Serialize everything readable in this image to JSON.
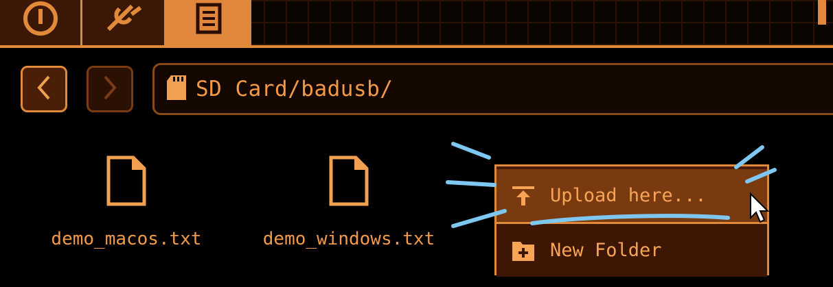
{
  "tabs": [
    {
      "name": "power",
      "icon": "power-icon"
    },
    {
      "name": "tools",
      "icon": "wrench-icon"
    },
    {
      "name": "files",
      "icon": "document-icon",
      "active": true
    }
  ],
  "navigation": {
    "back_icon": "chevron-left-icon",
    "forward_icon": "chevron-right-icon",
    "path_icon": "sd-card-icon",
    "path": "SD Card/badusb/"
  },
  "files": [
    {
      "name": "demo_macos.txt",
      "icon": "file-icon"
    },
    {
      "name": "demo_windows.txt",
      "icon": "file-icon"
    }
  ],
  "context_menu": {
    "items": [
      {
        "label": "Upload here...",
        "icon": "upload-icon",
        "highlighted": true
      },
      {
        "label": "New Folder",
        "icon": "new-folder-icon"
      }
    ]
  },
  "colors": {
    "accent": "#e08a3a",
    "text": "#f09a4a",
    "background": "#000000",
    "highlight": "#7a3a10",
    "annotation": "#7ec7f0"
  }
}
